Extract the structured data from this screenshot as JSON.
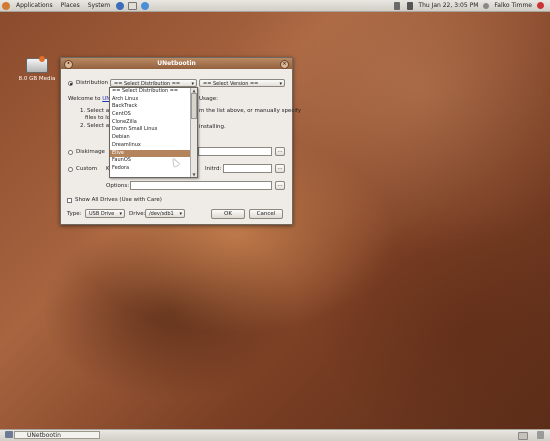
{
  "top_panel": {
    "menus": [
      "Applications",
      "Places",
      "System"
    ],
    "clock": "Thu Jan 22,  3:05 PM",
    "user": "Falko Timme"
  },
  "desktop": {
    "icon_label": "8.0 GB Media"
  },
  "dialog": {
    "title": "UNetbootin",
    "distribution_label": "Distribution",
    "distribution_value": "== Select Distribution ==",
    "version_value": "== Select Version ==",
    "welcome_prefix": "Welcome to ",
    "welcome_link": "UNet",
    "usage_label": "Usage:",
    "step1_start": "1. Select a d",
    "step1_end": "m the list above, or manually specify",
    "step1_line2": "files to loa",
    "step2_start": "2. Select an",
    "step2_end": "installing.",
    "diskimage_label": "Diskimage",
    "custom_label": "Custom",
    "custom_k": "K",
    "initrd_label": "Initrd:",
    "options_label": "Options:",
    "browse_label": "...",
    "show_all_drives": "Show All Drives (Use with Care)",
    "type_label": "Type:",
    "type_value": "USB Drive",
    "drive_label": "Drive:",
    "drive_value": "/dev/sdb1",
    "ok_label": "OK",
    "cancel_label": "Cancel"
  },
  "dropdown": {
    "options": [
      "== Select Distribution ==",
      "Arch Linux",
      "BackTrack",
      "CentOS",
      "CloneZilla",
      "Damn Small Linux",
      "Debian",
      "Dreamlinux",
      "Elive",
      "FaunOS",
      "Fedora"
    ],
    "selected_index": 8
  },
  "taskbar": {
    "window_title": "UNetbootin"
  },
  "colors": {
    "title_bar": "#93603e",
    "selection": "#b4855d",
    "link": "#2336b6"
  }
}
